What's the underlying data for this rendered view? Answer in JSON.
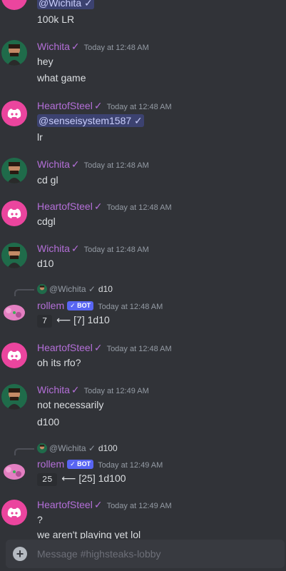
{
  "channel_placeholder": "Message #highsteaks-lobby",
  "messages": [
    {
      "kind": "partial",
      "mention": "@Wichita ✓",
      "lines": [
        "100k LR"
      ]
    },
    {
      "author": "Wichita",
      "check": "✓",
      "ts": "Today at 12:48 AM",
      "lines": [
        "hey",
        "what game"
      ]
    },
    {
      "author": "HeartofSteel",
      "check": "✓",
      "ts": "Today at 12:48 AM",
      "mention": "@senseisystem1587 ✓",
      "lines": [
        "lr"
      ]
    },
    {
      "author": "Wichita",
      "check": "✓",
      "ts": "Today at 12:48 AM",
      "lines": [
        "cd gl"
      ]
    },
    {
      "author": "HeartofSteel",
      "check": "✓",
      "ts": "Today at 12:48 AM",
      "lines": [
        "cdgl"
      ]
    },
    {
      "author": "Wichita",
      "check": "✓",
      "ts": "Today at 12:48 AM",
      "lines": [
        "d10"
      ]
    },
    {
      "author": "rollem",
      "badge": "✓ BOT",
      "ts": "Today at 12:48 AM",
      "reply": {
        "name": "@Wichita ✓",
        "msg": "d10"
      },
      "dice": "7",
      "roll": "⟵ [7] 1d10"
    },
    {
      "author": "HeartofSteel",
      "check": "✓",
      "ts": "Today at 12:48 AM",
      "lines": [
        "oh its rfo?"
      ]
    },
    {
      "author": "Wichita",
      "check": "✓",
      "ts": "Today at 12:49 AM",
      "lines": [
        "not necessarily",
        "d100"
      ]
    },
    {
      "author": "rollem",
      "badge": "✓ BOT",
      "ts": "Today at 12:49 AM",
      "reply": {
        "name": "@Wichita ✓",
        "msg": "d100"
      },
      "dice": "25",
      "roll": "⟵ [25] 1d100"
    },
    {
      "author": "HeartofSteel",
      "check": "✓",
      "ts": "Today at 12:49 AM",
      "lines": [
        "?",
        "we aren't playing yet lol"
      ]
    }
  ],
  "icons": {
    "discord": "discord-icon",
    "add": "plus-icon"
  },
  "colors": {
    "background": "#313338",
    "username": "#b46fd8",
    "bot_badge": "#5865f2",
    "discord_avatar": "#eb459e"
  }
}
